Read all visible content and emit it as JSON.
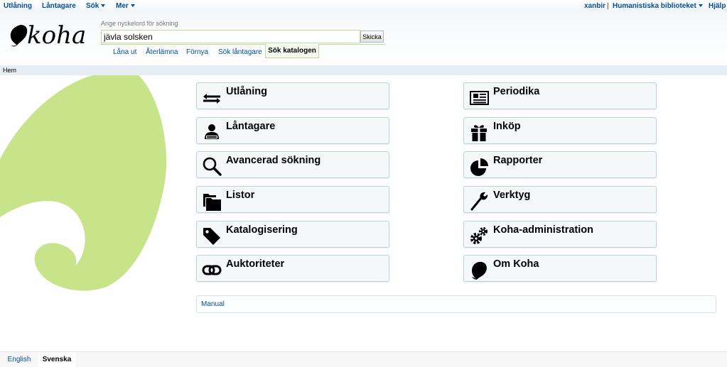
{
  "topnav": {
    "left": [
      "Utlåning",
      "Låntagare",
      "Sök",
      "Mer"
    ],
    "user": "xanbir",
    "separator": "|",
    "library": "Humanistiska biblioteket",
    "help": "Hjälp"
  },
  "logo": {
    "text": "koha"
  },
  "search": {
    "hint": "Ange nyckelord för sökning",
    "value": "jävla solsken",
    "submit": "Skicka",
    "tabs": [
      "Låna ut",
      "Återlämna",
      "Förnya",
      "Sök låntagare"
    ],
    "active_tab": "Sök katalogen"
  },
  "breadcrumb": {
    "home": "Hem"
  },
  "modules": {
    "left": [
      {
        "label": "Utlåning",
        "icon": "exchange-icon"
      },
      {
        "label": "Låntagare",
        "icon": "patron-icon"
      },
      {
        "label": "Avancerad sökning",
        "icon": "search-icon"
      },
      {
        "label": "Listor",
        "icon": "folders-icon"
      },
      {
        "label": "Katalogisering",
        "icon": "tag-icon"
      },
      {
        "label": "Auktoriteter",
        "icon": "link-icon"
      }
    ],
    "right": [
      {
        "label": "Periodika",
        "icon": "newspaper-icon"
      },
      {
        "label": "Inköp",
        "icon": "gift-icon"
      },
      {
        "label": "Rapporter",
        "icon": "pie-chart-icon"
      },
      {
        "label": "Verktyg",
        "icon": "wrench-icon"
      },
      {
        "label": "Koha-administration",
        "icon": "cogs-icon"
      },
      {
        "label": "Om Koha",
        "icon": "koha-leaf-icon"
      }
    ]
  },
  "manual": "Manual",
  "footer": {
    "languages": [
      "English",
      "Svenska"
    ],
    "active_language": "Svenska"
  },
  "colors": {
    "link": "#004d99",
    "accent_green": "#c7e48b",
    "tile_border": "#b9d3d6"
  }
}
